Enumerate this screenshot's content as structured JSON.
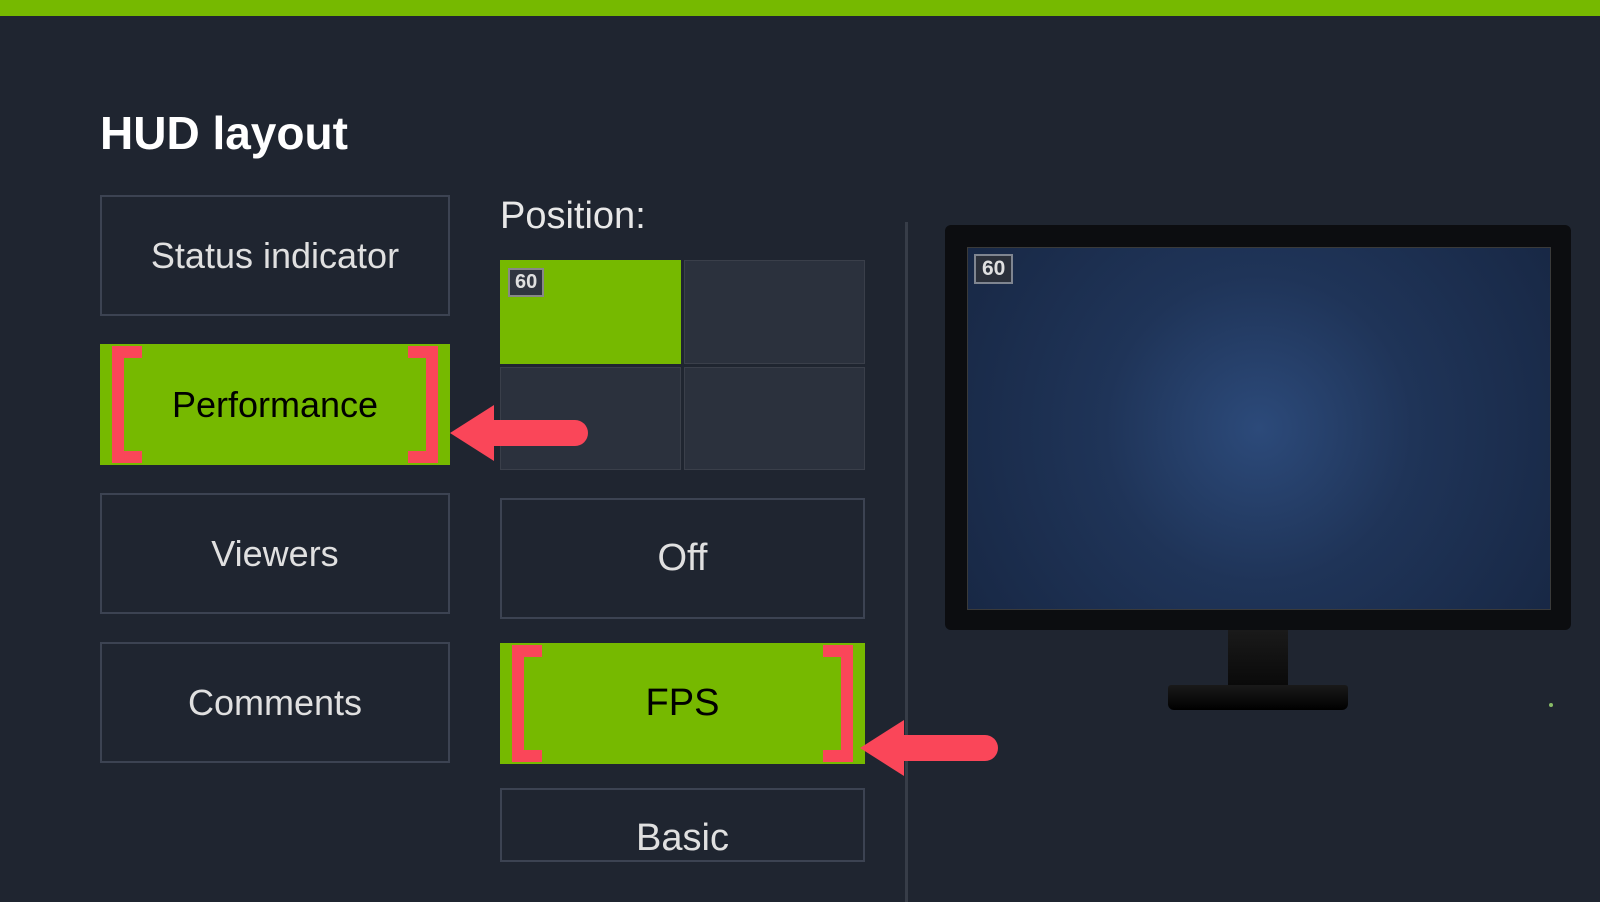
{
  "colors": {
    "accent": "#76b900",
    "highlight": "#fa4659",
    "bg": "#1f2530"
  },
  "page": {
    "title": "HUD layout"
  },
  "sidebar": {
    "items": [
      {
        "label": "Status indicator",
        "selected": false
      },
      {
        "label": "Performance",
        "selected": true
      },
      {
        "label": "Viewers",
        "selected": false
      },
      {
        "label": "Comments",
        "selected": false
      }
    ]
  },
  "position": {
    "label": "Position:",
    "selected": "top-left",
    "preview_value": "60"
  },
  "modes": {
    "items": [
      {
        "label": "Off",
        "selected": false
      },
      {
        "label": "FPS",
        "selected": true
      },
      {
        "label": "Basic",
        "selected": false
      }
    ]
  },
  "preview": {
    "overlay_value": "60"
  }
}
